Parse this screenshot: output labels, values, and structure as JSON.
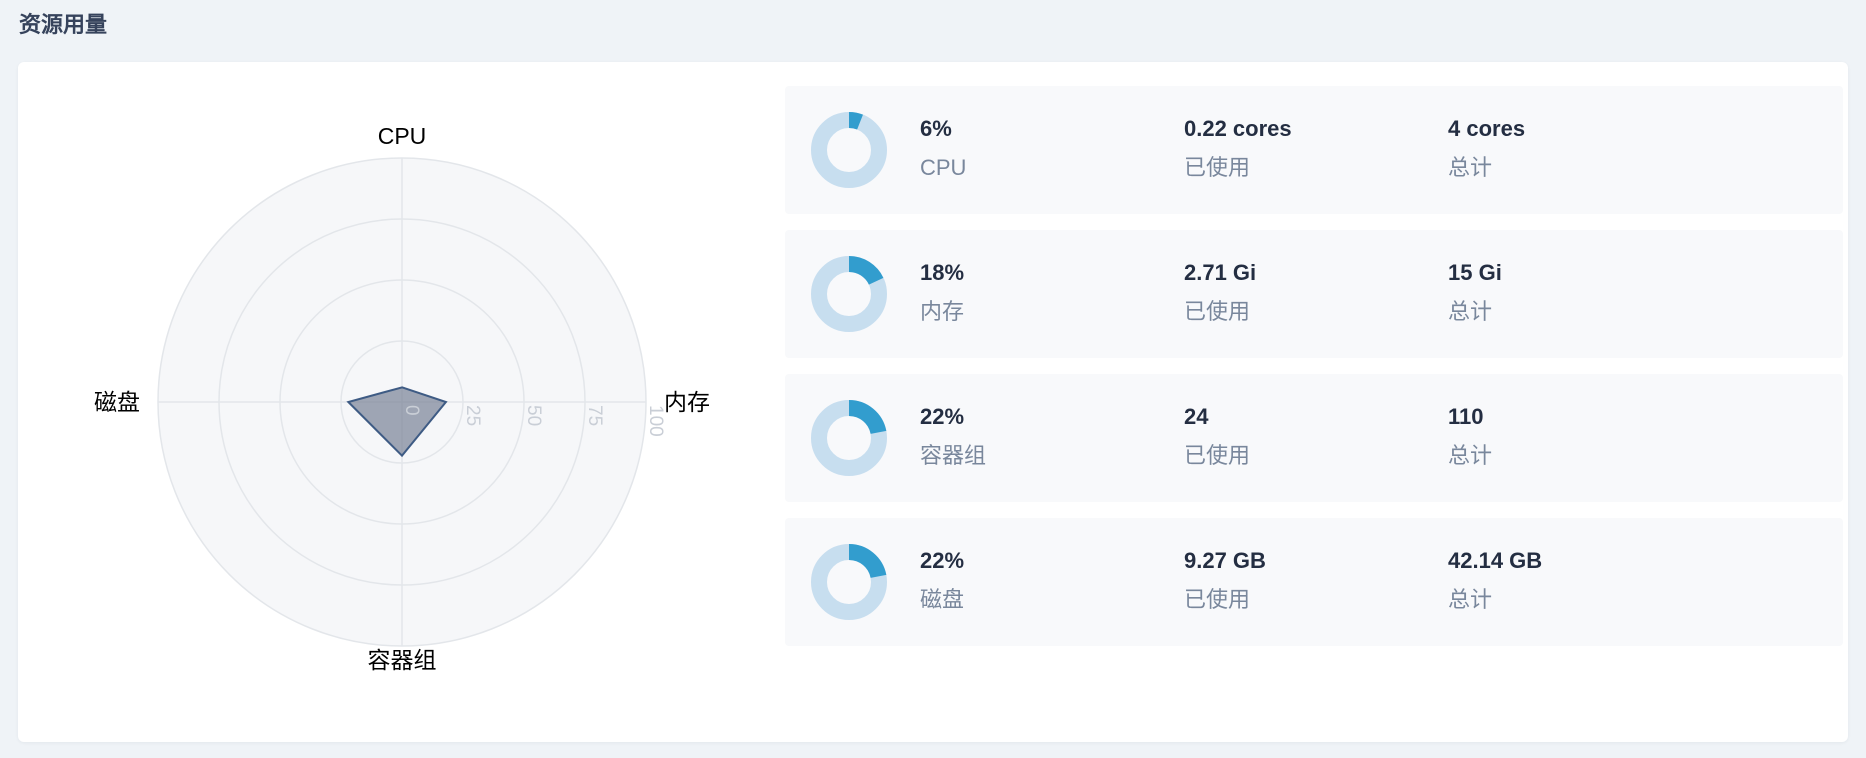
{
  "section_title": "资源用量",
  "colors": {
    "accent": "#329dce",
    "track": "#c7deef",
    "radar_fill": "#7c8598",
    "radar_stroke": "#3e5b84",
    "grid": "#e3e6ea",
    "radar_bg": "#f6f7f9"
  },
  "radar": {
    "axes": [
      "CPU",
      "内存",
      "容器组",
      "磁盘"
    ],
    "values": [
      6,
      18,
      22,
      22
    ],
    "max": 100,
    "ticks": [
      "0",
      "25",
      "50",
      "75",
      "100"
    ]
  },
  "resources": [
    {
      "percent_value": 6,
      "percent": "6%",
      "name": "CPU",
      "used": "0.22 cores",
      "used_label": "已使用",
      "total": "4 cores",
      "total_label": "总计",
      "icon": "donut-icon"
    },
    {
      "percent_value": 18,
      "percent": "18%",
      "name": "内存",
      "used": "2.71 Gi",
      "used_label": "已使用",
      "total": "15 Gi",
      "total_label": "总计",
      "icon": "donut-icon"
    },
    {
      "percent_value": 22,
      "percent": "22%",
      "name": "容器组",
      "used": "24",
      "used_label": "已使用",
      "total": "110",
      "total_label": "总计",
      "icon": "donut-icon"
    },
    {
      "percent_value": 22,
      "percent": "22%",
      "name": "磁盘",
      "used": "9.27 GB",
      "used_label": "已使用",
      "total": "42.14 GB",
      "total_label": "总计",
      "icon": "donut-icon"
    }
  ]
}
